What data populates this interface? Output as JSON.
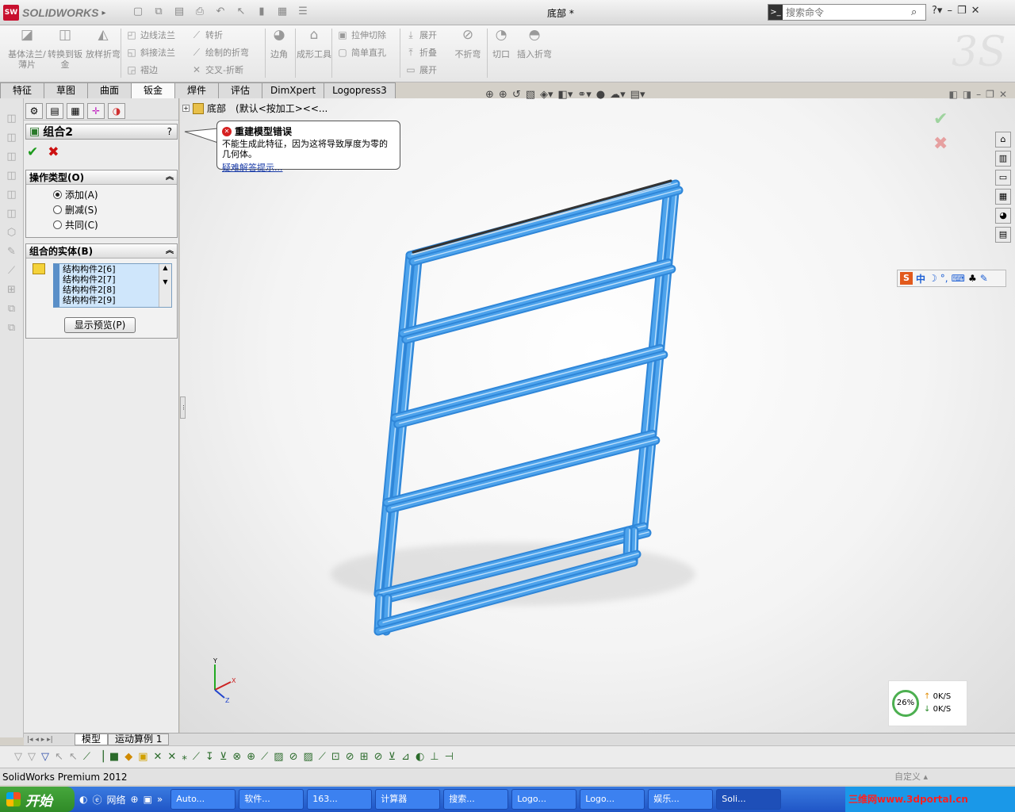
{
  "app": {
    "product": "SOLIDWORKS",
    "doc_title": "底部 *",
    "status_text": "SolidWorks Premium 2012",
    "status_right": "自定义 ▴"
  },
  "search": {
    "placeholder": "搜索命令"
  },
  "ribbon": {
    "big": [
      {
        "label": "基体法兰/薄片",
        "icon": "base-flange-icon"
      },
      {
        "label": "转换到钣金",
        "icon": "convert-sheetmetal-icon"
      },
      {
        "label": "放样折弯",
        "icon": "lofted-bend-icon"
      },
      {
        "label": "边角",
        "icon": "corner-icon"
      },
      {
        "label": "成形工具",
        "icon": "forming-tool-icon"
      },
      {
        "label": "不折弯",
        "icon": "no-bends-icon"
      },
      {
        "label": "切口",
        "icon": "rip-icon"
      },
      {
        "label": "插入折弯",
        "icon": "insert-bends-icon"
      }
    ],
    "small": [
      {
        "label": "边线法兰",
        "icon": "edge-flange-icon"
      },
      {
        "label": "斜接法兰",
        "icon": "miter-flange-icon"
      },
      {
        "label": "褶边",
        "icon": "hem-icon"
      },
      {
        "label": "转折",
        "icon": "jog-icon"
      },
      {
        "label": "绘制的折弯",
        "icon": "sketched-bend-icon"
      },
      {
        "label": "交叉-折断",
        "icon": "cross-break-icon"
      },
      {
        "label": "拉伸切除",
        "icon": "extruded-cut-icon"
      },
      {
        "label": "简单直孔",
        "icon": "simple-hole-icon"
      },
      {
        "label": "展开",
        "icon": "unfold-icon"
      },
      {
        "label": "折叠",
        "icon": "fold-icon"
      },
      {
        "label": "展开",
        "icon": "flatten-icon"
      }
    ]
  },
  "tabs": [
    "特征",
    "草图",
    "曲面",
    "钣金",
    "焊件",
    "评估",
    "DimXpert",
    "Logopress3"
  ],
  "active_tab": "钣金",
  "pm": {
    "title": "组合2",
    "help": "?",
    "op_group": {
      "title": "操作类型(O)",
      "options": [
        "添加(A)",
        "删减(S)",
        "共同(C)"
      ],
      "selected": "添加(A)"
    },
    "body_group": {
      "title": "组合的实体(B)",
      "items": [
        "结构构件2[6]",
        "结构构件2[7]",
        "结构构件2[8]",
        "结构构件2[9]"
      ],
      "preview_button": "显示预览(P)"
    }
  },
  "viewport": {
    "tree_label": "底部",
    "config_label": "(默认<按加工><<...",
    "error": {
      "title": "重建模型错误",
      "message": "不能生成此特征，因为这将导致厚度为零的几何体。",
      "link": "疑难解答提示..."
    },
    "frame_color": "#4da3ec",
    "ime_label": "中",
    "net": {
      "percent": "26%",
      "up": "0K/S",
      "down": "0K/S"
    }
  },
  "model_tabs": [
    "模型",
    "运动算例 1"
  ],
  "taskbar": {
    "start": "开始",
    "quicklaunch": "网络",
    "items": [
      "Auto...",
      "软件...",
      "163...",
      "计算器",
      "搜索...",
      "Logo...",
      "Logo...",
      "娱乐...",
      "Soli..."
    ],
    "watermark": "三维网www.3dportal.cn"
  }
}
